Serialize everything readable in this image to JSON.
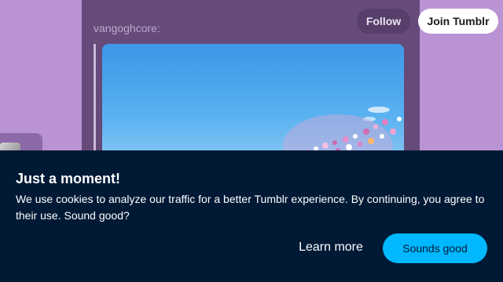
{
  "post": {
    "author": "vangoghcore",
    "author_suffix": ":",
    "image_alt": "flowers under blue sky"
  },
  "header": {
    "follow_label": "Follow",
    "join_label": "Join Tumblr"
  },
  "cookie_banner": {
    "title": "Just a moment!",
    "body": "We use cookies to analyze our traffic for a better Tumblr experience. By continuing, you agree to their use. Sound good?",
    "learn_more_label": "Learn more",
    "accept_label": "Sounds good"
  },
  "colors": {
    "background": "#b993d3",
    "post_card": "#654a7a",
    "banner": "#001935",
    "accent": "#00b8ff"
  }
}
